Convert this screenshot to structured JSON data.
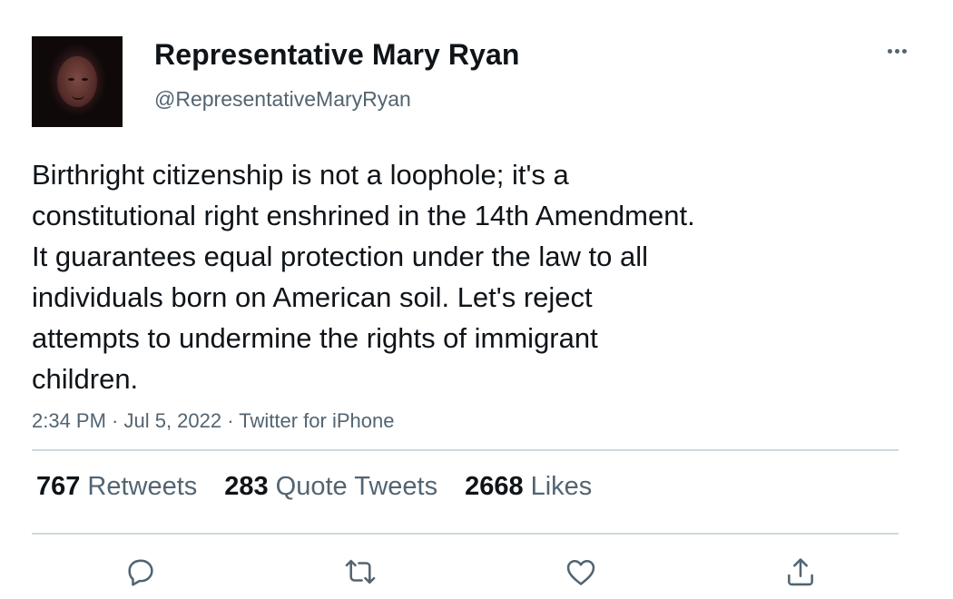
{
  "author": {
    "display_name": "Representative Mary Ryan",
    "handle": "@RepresentativeMaryRyan"
  },
  "tweet": {
    "text_lines": [
      "Birthright citizenship is not a loophole; it's a",
      "constitutional right enshrined in the 14th Amendment.",
      "It guarantees equal protection under the law to all",
      "individuals born on American soil. Let's reject",
      "attempts to undermine the rights of immigrant",
      "children."
    ],
    "meta": "2:34 PM · Jul 5, 2022 · Twitter for iPhone"
  },
  "stats": {
    "retweets": {
      "count": "767",
      "label": "Retweets"
    },
    "quote_tweets": {
      "count": "283",
      "label": "Quote Tweets"
    },
    "likes": {
      "count": "2668",
      "label": "Likes"
    }
  },
  "icons": {
    "more": "more-horizontal-icon",
    "reply": "reply-icon",
    "retweet": "retweet-icon",
    "like": "heart-icon",
    "share": "share-icon"
  },
  "colors": {
    "text": "#0f1419",
    "secondary": "#536471",
    "divider": "#cfd9de"
  }
}
